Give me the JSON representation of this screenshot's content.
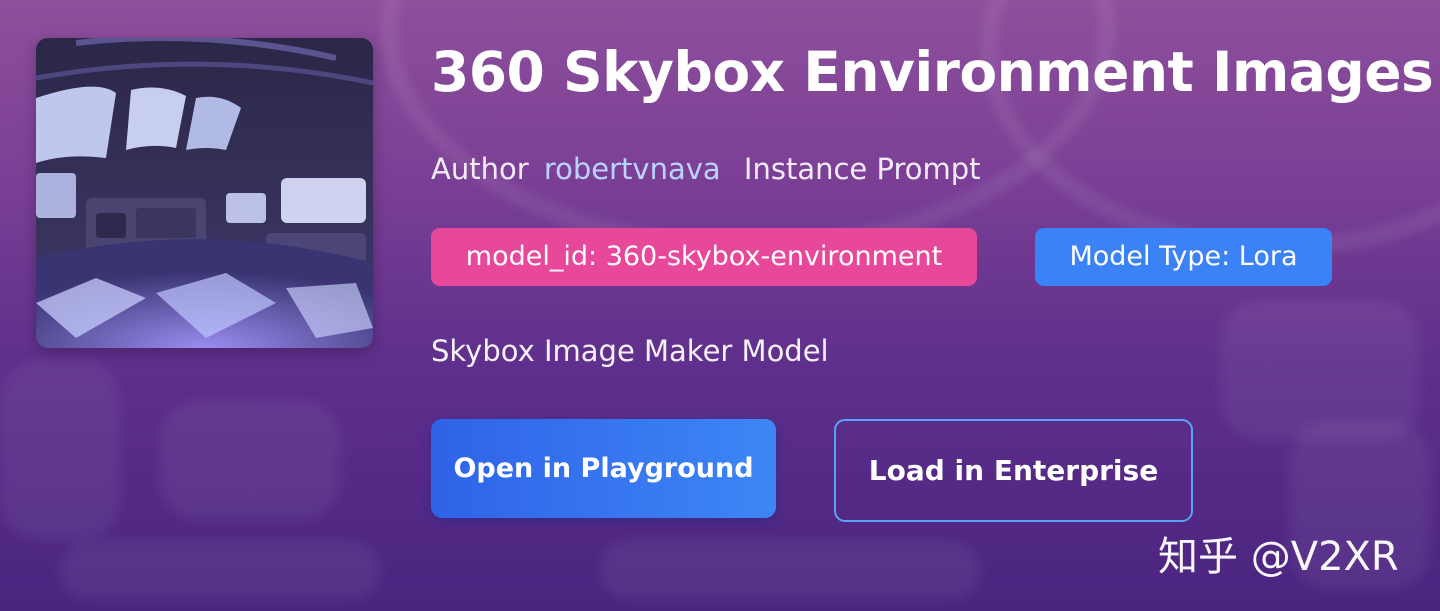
{
  "header": {
    "title": "360 Skybox Environment Images"
  },
  "author": {
    "label": "Author",
    "name": "robertvnava",
    "instance_prompt_label": "Instance Prompt"
  },
  "badges": {
    "model_id": "model_id: 360-skybox-environment",
    "model_type": "Model Type: Lora"
  },
  "description": "Skybox Image Maker Model",
  "actions": {
    "playground_label": "Open in Playground",
    "enterprise_label": "Load in Enterprise"
  },
  "watermark": "知乎 @V2XR",
  "colors": {
    "model_id_badge": "#e8489a",
    "model_type_badge": "#3b82f6",
    "primary_button": "#3b82f6",
    "author_link": "#bcd3ff",
    "outline_button_border": "#5aa2f5"
  },
  "thumbnail": {
    "subject": "360-panorama-spaceship-interior"
  }
}
